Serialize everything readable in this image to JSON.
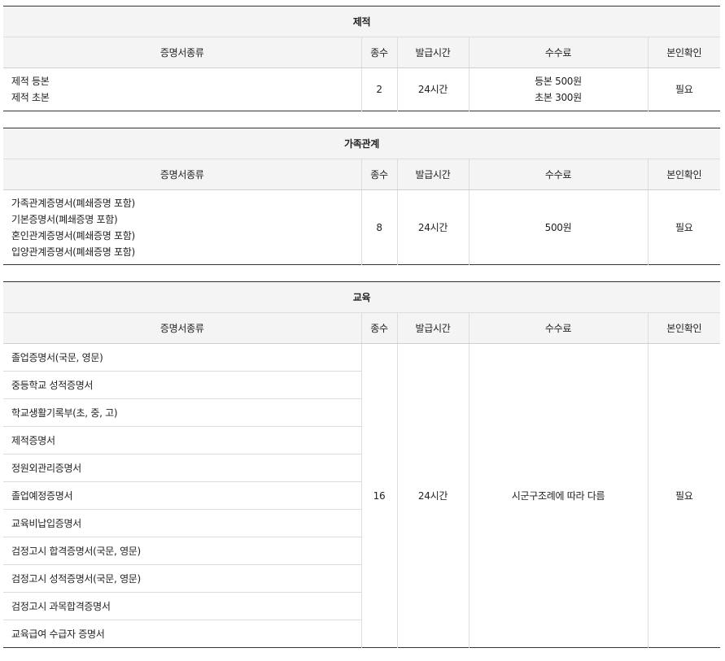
{
  "columns": {
    "type": "증명서종류",
    "count": "종수",
    "time": "발급시간",
    "fee": "수수료",
    "verify": "본인확인"
  },
  "sections": [
    {
      "title": "제적",
      "items": [
        "제적 등본",
        "제적 초본"
      ],
      "count": "2",
      "time": "24시간",
      "fee_lines": [
        "등본 500원",
        "초본 300원"
      ],
      "verify": "필요"
    },
    {
      "title": "가족관계",
      "items": [
        "가족관계증명서(폐쇄증명 포함)",
        "기본증명서(폐쇄증명 포함)",
        "혼인관계증명서(폐쇄증명 포함)",
        "입양관계증명서(폐쇄증명 포함)"
      ],
      "count": "8",
      "time": "24시간",
      "fee": "500원",
      "verify": "필요"
    },
    {
      "title": "교육",
      "items": [
        "졸업증명서(국문, 영문)",
        "중등학교 성적증명서",
        "학교생활기록부(초, 중, 고)",
        "제적증명서",
        "정원외관리증명서",
        "졸업예정증명서",
        "교육비납입증명서",
        "검정고시 합격증명서(국문, 영문)",
        "검정고시 성적증명서(국문, 영문)",
        "검정고시 과목합격증명서",
        "교육급여 수급자 증명서"
      ],
      "count": "16",
      "time": "24시간",
      "fee": "시군구조례에 따라 다름",
      "verify": "필요"
    }
  ]
}
